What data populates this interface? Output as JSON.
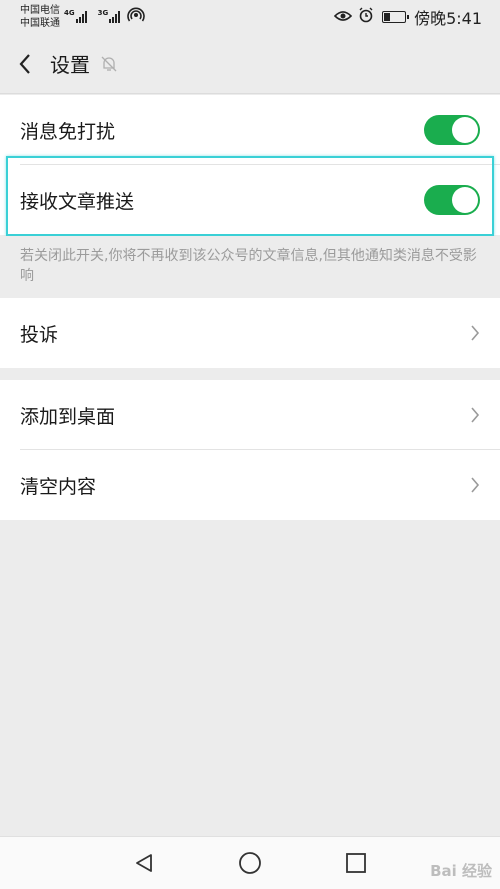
{
  "statusbar": {
    "carrier1": "中国电信",
    "carrier2": "中国联通",
    "net1": "4G",
    "net2": "3G",
    "time": "傍晚5:41"
  },
  "header": {
    "title": "设置"
  },
  "settings": {
    "dnd_label": "消息免打扰",
    "dnd_on": true,
    "receive_label": "接收文章推送",
    "receive_on": true,
    "note": "若关闭此开关,你将不再收到该公众号的文章信息,但其他通知类消息不受影响",
    "complain_label": "投诉",
    "add_desktop_label": "添加到桌面",
    "clear_label": "清空内容"
  },
  "watermark": "Bai 经验",
  "colors": {
    "toggle_on": "#1aad4e",
    "highlight": "#3ad0d6",
    "background": "#ececec"
  }
}
